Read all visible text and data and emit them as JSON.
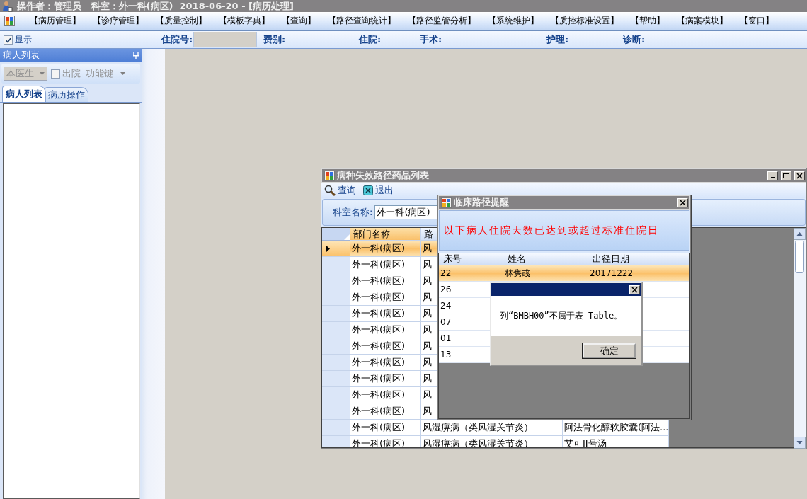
{
  "window": {
    "title": "操作者：管理员   科室：外一科(病区)  2018-06-20 - [病历处理]"
  },
  "menu": {
    "items": [
      "【病历管理】",
      "【诊疗管理】",
      "【质量控制】",
      "【模板字典】",
      "【查询】",
      "【路径查询统计】",
      "【路径监管分析】",
      "【系统维护】",
      "【质控标准设置】",
      "【帮助】",
      "【病案模块】",
      "【窗口】"
    ]
  },
  "info_bar": {
    "show_toggle": {
      "label": "显示",
      "checked": true
    },
    "fields": [
      {
        "label": "住院号:",
        "kind": "input"
      },
      {
        "label": "费别:",
        "kind": "label"
      },
      {
        "label": "住院:",
        "kind": "label"
      },
      {
        "label": "手术:",
        "kind": "label"
      },
      {
        "label": "护理:",
        "kind": "label"
      },
      {
        "label": "诊断:",
        "kind": "label"
      }
    ]
  },
  "patient_panel": {
    "title": "病人列表",
    "doctor_filter": {
      "value": "本医生",
      "disabled": true
    },
    "discharged": {
      "label": "出院",
      "checked": false,
      "disabled": true
    },
    "function_menu": {
      "label": "功能键"
    },
    "tabs": [
      {
        "label": "病人列表",
        "selected": true
      },
      {
        "label": "病历操作",
        "selected": false
      }
    ]
  },
  "drug_window": {
    "title": "病种失效路径药品列表",
    "toolbar": [
      {
        "label": "查询",
        "kind": "search"
      },
      {
        "label": "退出",
        "kind": "exit"
      }
    ],
    "filter": {
      "label": "科室名称:",
      "value": "外一科(病区)"
    },
    "table": {
      "columns": [
        {
          "label": "部门名称",
          "selected": true
        },
        {
          "label": "路",
          "selected": false
        }
      ],
      "rows": [
        {
          "selected": true,
          "cells": [
            "外一科(病区)",
            "风"
          ]
        },
        {
          "selected": false,
          "cells": [
            "外一科(病区)",
            "风"
          ]
        },
        {
          "selected": false,
          "cells": [
            "外一科(病区)",
            "风"
          ]
        },
        {
          "selected": false,
          "cells": [
            "外一科(病区)",
            "风"
          ]
        },
        {
          "selected": false,
          "cells": [
            "外一科(病区)",
            "风"
          ]
        },
        {
          "selected": false,
          "cells": [
            "外一科(病区)",
            "风"
          ]
        },
        {
          "selected": false,
          "cells": [
            "外一科(病区)",
            "风"
          ]
        },
        {
          "selected": false,
          "cells": [
            "外一科(病区)",
            "风"
          ]
        },
        {
          "selected": false,
          "cells": [
            "外一科(病区)",
            "风"
          ]
        },
        {
          "selected": false,
          "cells": [
            "外一科(病区)",
            "风"
          ]
        },
        {
          "selected": false,
          "cells": [
            "外一科(病区)",
            "风"
          ]
        },
        {
          "selected": false,
          "cells": [
            "外一科(病区)",
            "风湿痹病（类风湿关节炎）",
            "阿法骨化醇软胶囊(阿法..."
          ]
        },
        {
          "selected": false,
          "cells": [
            "外一科(病区)",
            "风湿痹病（类风湿关节炎）",
            "艾可II号汤"
          ]
        }
      ]
    }
  },
  "reminder_window": {
    "title": "临床路径提醒",
    "message": "以下病人住院天数已达到或超过标准住院日",
    "table": {
      "columns": [
        "床号",
        "姓名",
        "出径日期"
      ],
      "rows": [
        {
          "selected": true,
          "cells": [
            "22",
            "林隽彧",
            "20171222"
          ]
        },
        {
          "selected": false,
          "cells": [
            "26"
          ]
        },
        {
          "selected": false,
          "cells": [
            "24"
          ]
        },
        {
          "selected": false,
          "cells": [
            "07"
          ]
        },
        {
          "selected": false,
          "cells": [
            "01"
          ]
        },
        {
          "selected": false,
          "cells": [
            "13"
          ]
        }
      ]
    }
  },
  "message_box": {
    "message": "列“BMBH00”不属于表 Table。",
    "buttons": [
      "确定"
    ]
  }
}
